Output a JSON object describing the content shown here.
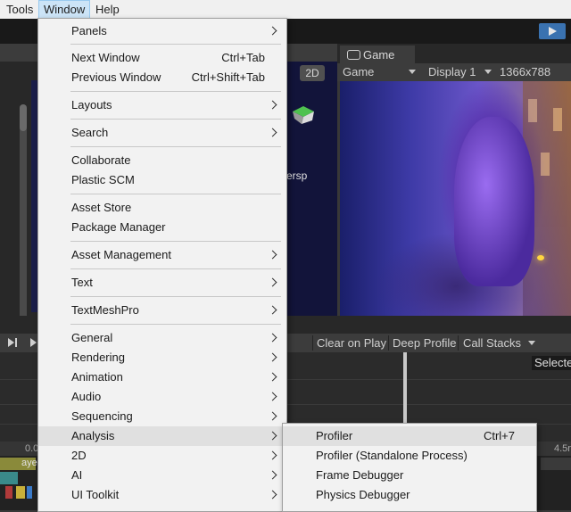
{
  "menubar": {
    "items": [
      {
        "label": "Tools"
      },
      {
        "label": "Window"
      },
      {
        "label": "Help"
      }
    ]
  },
  "scene": {
    "btn_2d": "2D",
    "persp_label": "ersp"
  },
  "game": {
    "tab_label": "Game",
    "view_mode": "Game",
    "display": "Display 1",
    "resolution": "1366x788"
  },
  "profiler": {
    "clear_on_play": "Clear on Play",
    "deep_profile": "Deep Profile",
    "call_stacks": "Call Stacks",
    "selected": "Selecte",
    "timeline_start": "0.0",
    "timeline_end": "4.5n",
    "track_label": "aye"
  },
  "window_menu": {
    "items": [
      {
        "label": "Panels",
        "submenu": true
      },
      {
        "label": "Next Window",
        "shortcut": "Ctrl+Tab"
      },
      {
        "label": "Previous Window",
        "shortcut": "Ctrl+Shift+Tab"
      },
      {
        "label": "Layouts",
        "submenu": true
      },
      {
        "label": "Search",
        "submenu": true
      },
      {
        "label": "Collaborate"
      },
      {
        "label": "Plastic SCM"
      },
      {
        "label": "Asset Store"
      },
      {
        "label": "Package Manager"
      },
      {
        "label": "Asset Management",
        "submenu": true
      },
      {
        "label": "Text",
        "submenu": true
      },
      {
        "label": "TextMeshPro",
        "submenu": true
      },
      {
        "label": "General",
        "submenu": true
      },
      {
        "label": "Rendering",
        "submenu": true
      },
      {
        "label": "Animation",
        "submenu": true
      },
      {
        "label": "Audio",
        "submenu": true
      },
      {
        "label": "Sequencing",
        "submenu": true
      },
      {
        "label": "Analysis",
        "submenu": true,
        "highlighted": true
      },
      {
        "label": "2D",
        "submenu": true
      },
      {
        "label": "AI",
        "submenu": true
      },
      {
        "label": "UI Toolkit",
        "submenu": true
      }
    ]
  },
  "analysis_menu": {
    "items": [
      {
        "label": "Profiler",
        "shortcut": "Ctrl+7",
        "highlighted": true
      },
      {
        "label": "Profiler (Standalone Process)"
      },
      {
        "label": "Frame Debugger"
      },
      {
        "label": "Physics Debugger"
      }
    ]
  },
  "colors": {
    "menu_bg": "#f2f2f2",
    "highlight": "#e0e0e0",
    "play_button": "#3a72b0"
  }
}
